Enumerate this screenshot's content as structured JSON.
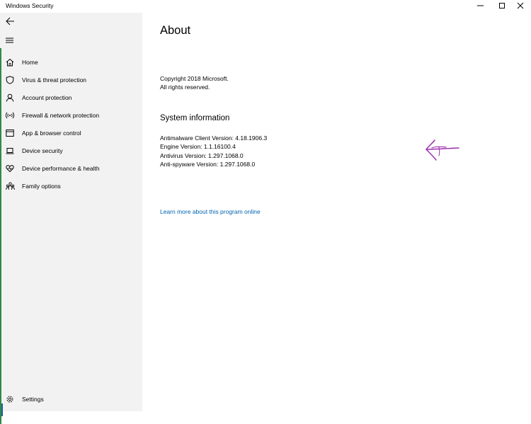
{
  "titlebar": {
    "title": "Windows Security"
  },
  "sidebar": {
    "items": [
      {
        "label": "Home",
        "icon": "home-icon"
      },
      {
        "label": "Virus & threat protection",
        "icon": "shield-icon"
      },
      {
        "label": "Account protection",
        "icon": "person-icon"
      },
      {
        "label": "Firewall & network protection",
        "icon": "wifi-signal-icon"
      },
      {
        "label": "App & browser control",
        "icon": "browser-window-icon"
      },
      {
        "label": "Device security",
        "icon": "laptop-icon"
      },
      {
        "label": "Device performance & health",
        "icon": "heart-icon"
      },
      {
        "label": "Family options",
        "icon": "family-icon"
      }
    ],
    "settings": {
      "label": "Settings",
      "icon": "gear-icon"
    }
  },
  "main": {
    "title": "About",
    "copyright": {
      "line1": "Copyright 2018 Microsoft.",
      "line2": "All rights reserved."
    },
    "system_info": {
      "heading": "System information",
      "antimalware": "Antimalware Client Version: 4.18.1906.3",
      "engine": "Engine Version: 1.1.16100.4",
      "antivirus": "Antivirus Version: 1.297.1068.0",
      "antispyware": "Anti-spyware Version: 1.297.1068.0"
    },
    "learn_more_link": "Learn more about this program online"
  },
  "colors": {
    "sidebar_bg": "#f2f2f2",
    "accent_green": "#2e8b45",
    "link_blue": "#0063b1",
    "annotation_purple": "#9b2fae"
  }
}
